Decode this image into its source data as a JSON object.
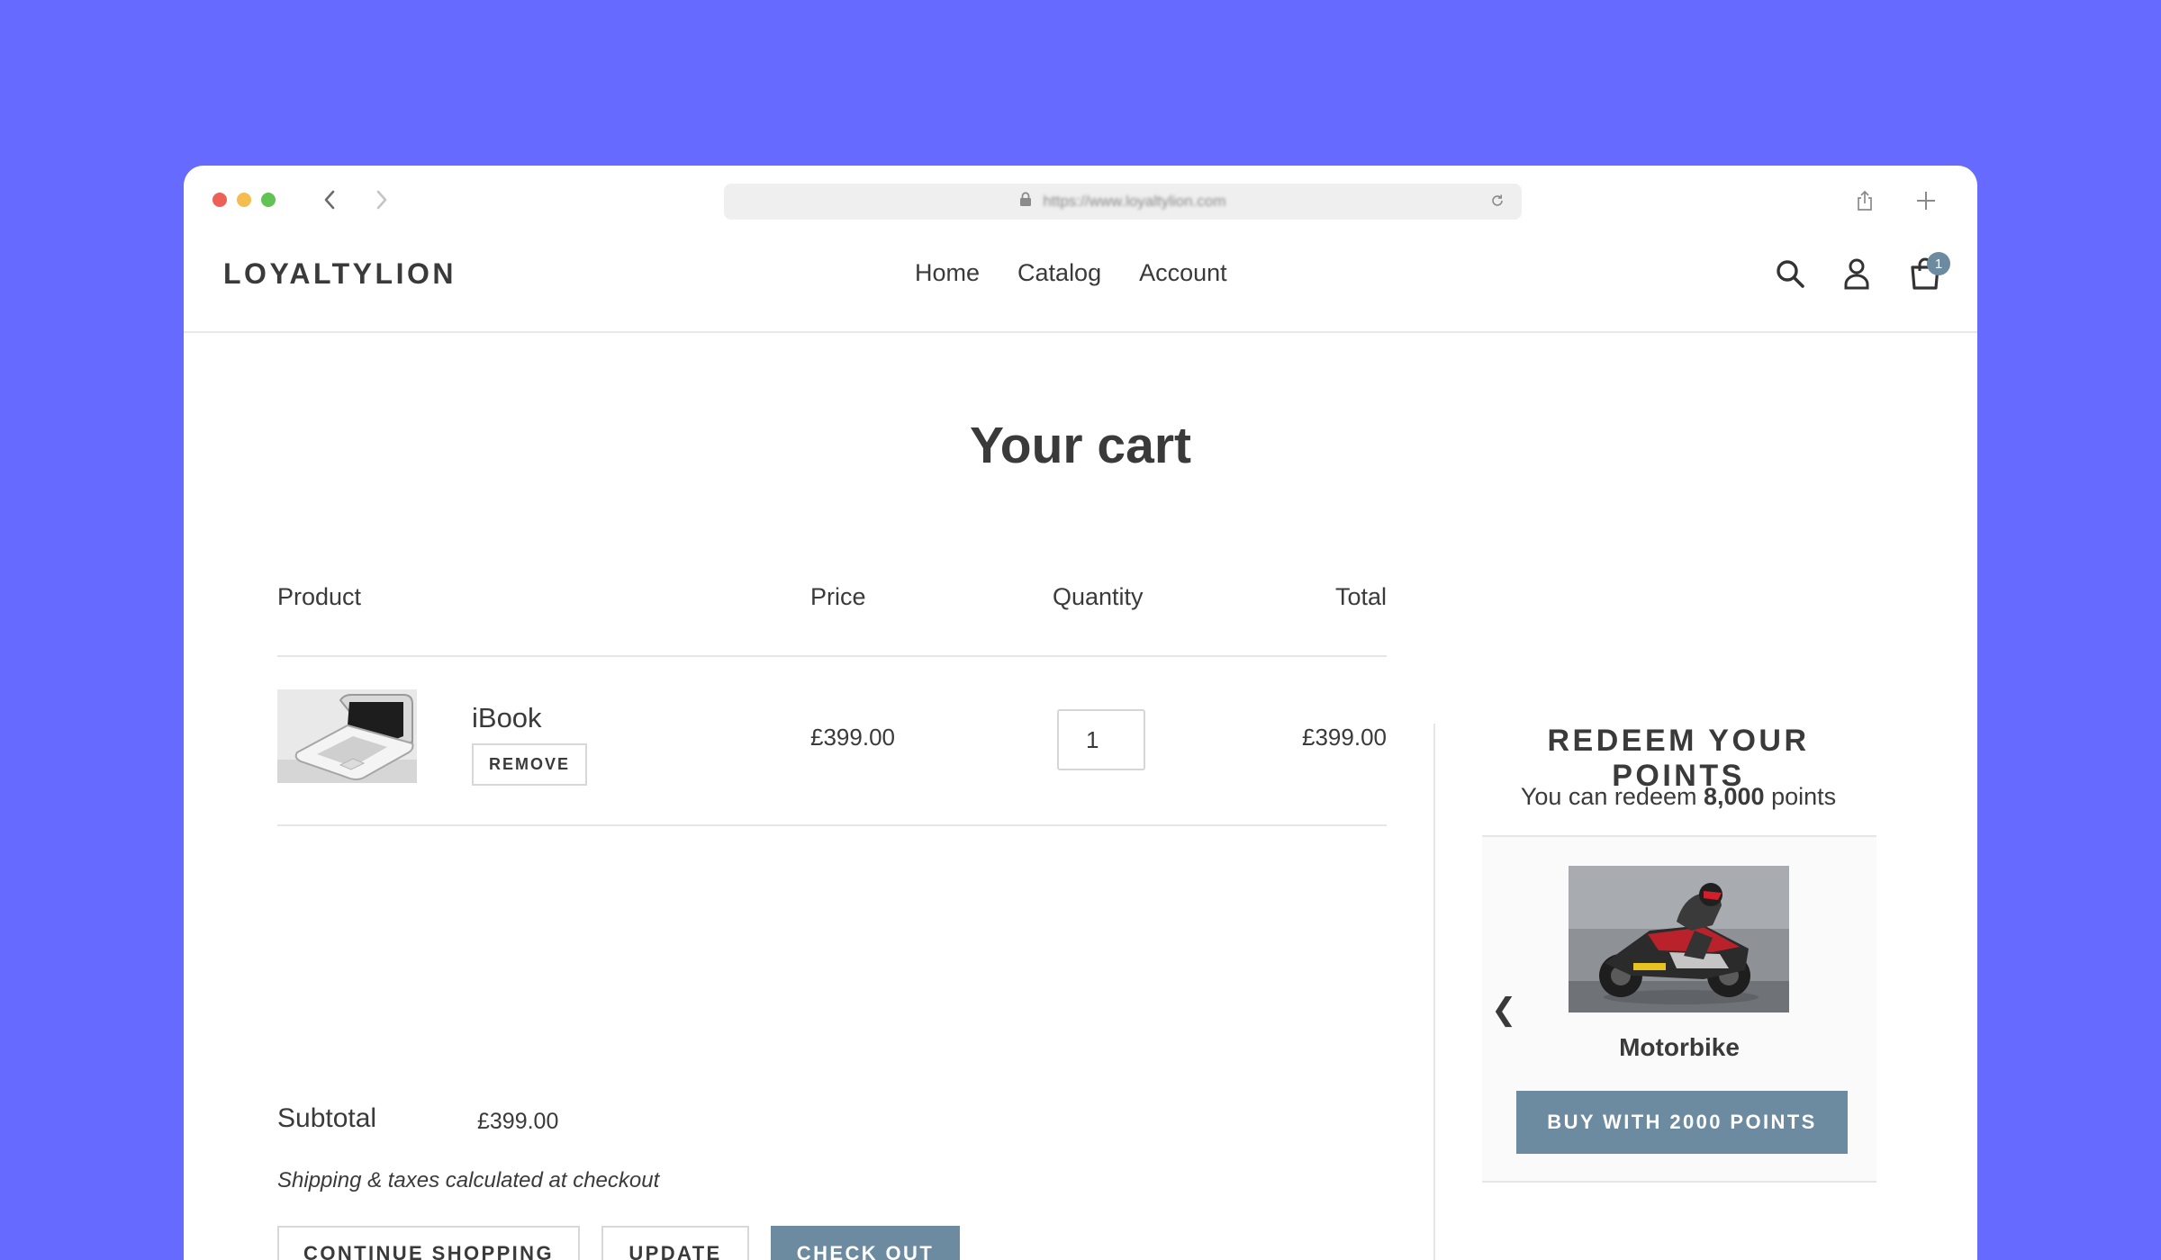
{
  "browser": {
    "url": "https://www.loyaltylion.com"
  },
  "header": {
    "logo": "LOYALTYLION",
    "nav": [
      "Home",
      "Catalog",
      "Account"
    ],
    "cart_count": "1"
  },
  "page": {
    "title": "Your cart"
  },
  "cart": {
    "columns": {
      "product": "Product",
      "price": "Price",
      "quantity": "Quantity",
      "total": "Total"
    },
    "items": [
      {
        "name": "iBook",
        "remove_label": "REMOVE",
        "price": "£399.00",
        "quantity": "1",
        "total": "£399.00"
      }
    ],
    "subtotal_label": "Subtotal",
    "subtotal_value": "£399.00",
    "shipping_note": "Shipping & taxes calculated at checkout",
    "buttons": {
      "continue": "CONTINUE SHOPPING",
      "update": "UPDATE",
      "checkout": "CHECK OUT"
    }
  },
  "redeem": {
    "title": "REDEEM YOUR POINTS",
    "sub_prefix": "You can redeem",
    "points": "8,000",
    "sub_suffix": "points",
    "prev_arrow": "❮",
    "reward": {
      "name": "Motorbike",
      "button": "BUY WITH 2000 POINTS"
    }
  },
  "colors": {
    "background": "#666AFF",
    "accent": "#6C8AA0",
    "text": "#3a3a3a"
  }
}
